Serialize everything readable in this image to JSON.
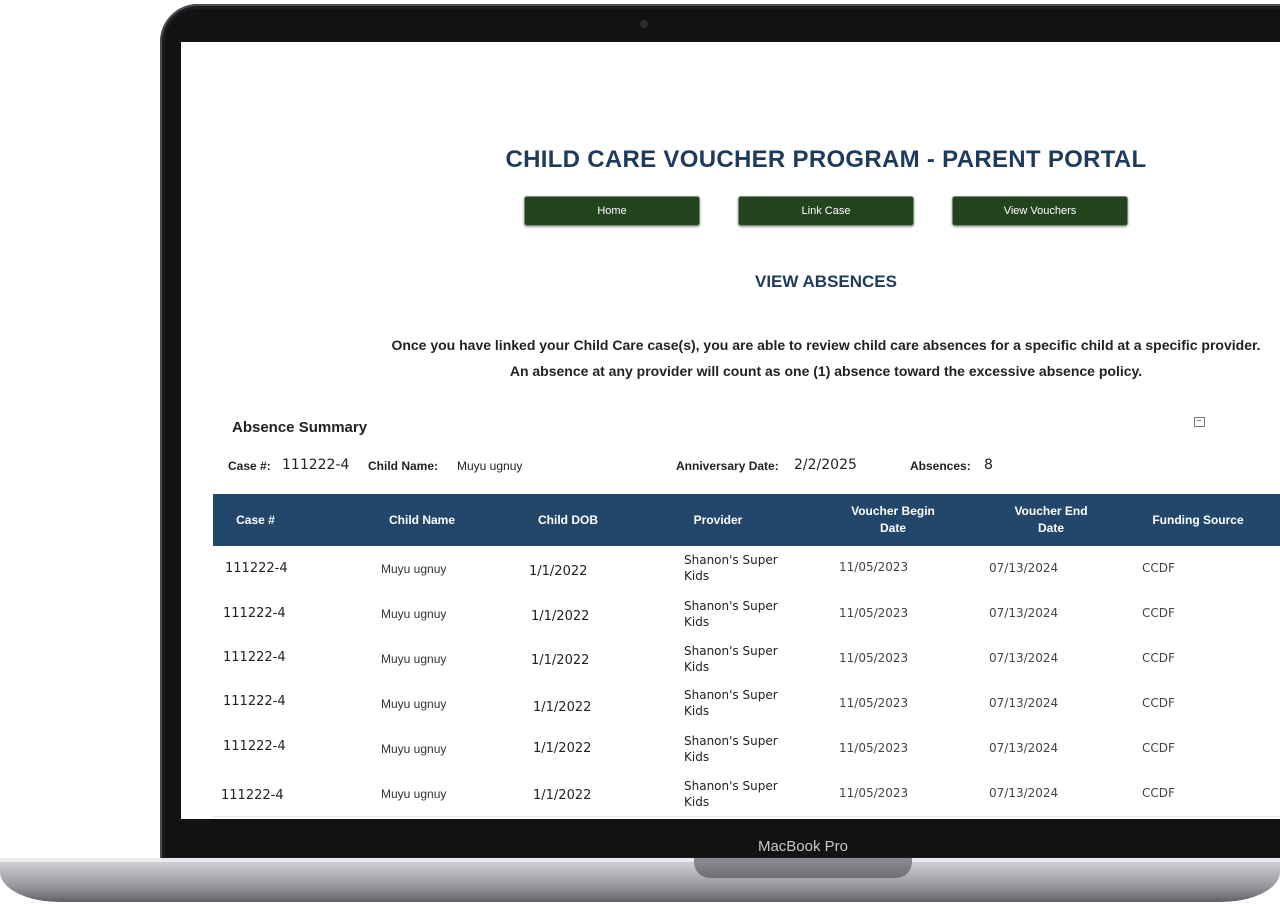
{
  "device": {
    "label": "MacBook Pro"
  },
  "portal": {
    "title": "CHILD CARE VOUCHER PROGRAM - PARENT PORTAL",
    "nav": [
      {
        "label": "Home"
      },
      {
        "label": "Link Case"
      },
      {
        "label": "View Vouchers"
      }
    ]
  },
  "page": {
    "title": "VIEW ABSENCES",
    "intro_line1": "Once you have linked your Child Care case(s), you are able to review child care absences for a specific child at a specific provider.",
    "intro_line2": "An absence at any provider will count as one (1) absence toward the excessive absence policy."
  },
  "summary": {
    "title": "Absence Summary",
    "case_label": "Case #:",
    "case_value": "111222-4",
    "child_label": "Child Name:",
    "child_value": "Muyu ugnuy",
    "anniv_label": "Anniversary Date:",
    "anniv_value": "2/2/2025",
    "absences_label": "Absences:",
    "absences_value": "8"
  },
  "table": {
    "headers": [
      "Case #",
      "Child Name",
      "Child DOB",
      "Provider",
      "Voucher Begin Date",
      "Voucher End Date",
      "Funding Source"
    ],
    "rows": [
      {
        "case": "111222-4",
        "child": "Muyu ugnuy",
        "dob": "1/1/2022",
        "provider": "Shanon's Super Kids",
        "begin": "11/05/2023",
        "end": "07/13/2024",
        "funding": "CCDF"
      },
      {
        "case": "111222-4",
        "child": "Muyu ugnuy",
        "dob": "1/1/2022",
        "provider": "Shanon's Super Kids",
        "begin": "11/05/2023",
        "end": "07/13/2024",
        "funding": "CCDF"
      },
      {
        "case": "111222-4",
        "child": "Muyu ugnuy",
        "dob": "1/1/2022",
        "provider": "Shanon's Super Kids",
        "begin": "11/05/2023",
        "end": "07/13/2024",
        "funding": "CCDF"
      },
      {
        "case": "111222-4",
        "child": "Muyu ugnuy",
        "dob": "1/1/2022",
        "provider": "Shanon's Super Kids",
        "begin": "11/05/2023",
        "end": "07/13/2024",
        "funding": "CCDF"
      },
      {
        "case": "111222-4",
        "child": "Muyu ugnuy",
        "dob": "1/1/2022",
        "provider": "Shanon's Super Kids",
        "begin": "11/05/2023",
        "end": "07/13/2024",
        "funding": "CCDF"
      },
      {
        "case": "111222-4",
        "child": "Muyu ugnuy",
        "dob": "1/1/2022",
        "provider": "Shanon's Super Kids",
        "begin": "11/05/2023",
        "end": "07/13/2024",
        "funding": "CCDF"
      }
    ]
  },
  "colors": {
    "title": "#1f3b5c",
    "nav_button": "#24441f",
    "table_header": "#23466b"
  }
}
